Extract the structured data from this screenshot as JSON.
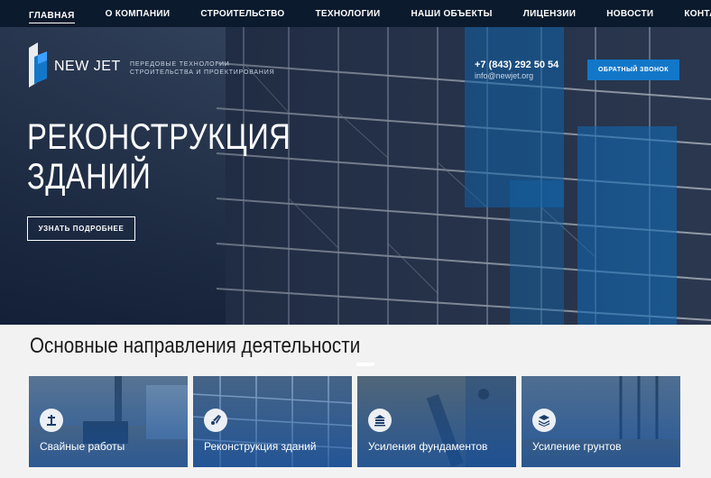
{
  "nav": {
    "items": [
      {
        "label": "ГЛАВНАЯ"
      },
      {
        "label": "О КОМПАНИИ"
      },
      {
        "label": "СТРОИТЕЛЬСТВО"
      },
      {
        "label": "ТЕХНОЛОГИИ"
      },
      {
        "label": "НАШИ ОБЪЕКТЫ"
      },
      {
        "label": "ЛИЦЕНЗИИ"
      },
      {
        "label": "НОВОСТИ"
      },
      {
        "label": "КОНТАКТЫ"
      }
    ],
    "active_index": 0
  },
  "header": {
    "logo_text": "NEW JET",
    "tagline_line1": "ПЕРЕДОВЫЕ ТЕХНОЛОГИИ",
    "tagline_line2": "СТРОИТЕЛЬСТВА И ПРОЕКТИРОВАНИЯ",
    "phone": "+7 (843) 292 50 54",
    "email": "info@newjet.org",
    "callback_label": "ОБРАТНЫЙ ЗВОНОК"
  },
  "hero": {
    "title_line1": "РЕКОНСТРУКЦИЯ",
    "title_line2": "ЗДАНИЙ",
    "button_label": "УЗНАТЬ ПОДРОБНЕЕ"
  },
  "directions": {
    "title": "Основные направления деятельности",
    "cards": [
      {
        "label": "Свайные работы",
        "icon": "pile-driver-icon"
      },
      {
        "label": "Реконструкция зданий",
        "icon": "rocket-icon"
      },
      {
        "label": "Усиления фундаментов",
        "icon": "foundation-icon"
      },
      {
        "label": "Усиление грунтов",
        "icon": "layers-icon"
      }
    ]
  },
  "colors": {
    "accent": "#1377c9",
    "nav_bg": "#0b1a2c",
    "card_tint": "#1250a0"
  }
}
